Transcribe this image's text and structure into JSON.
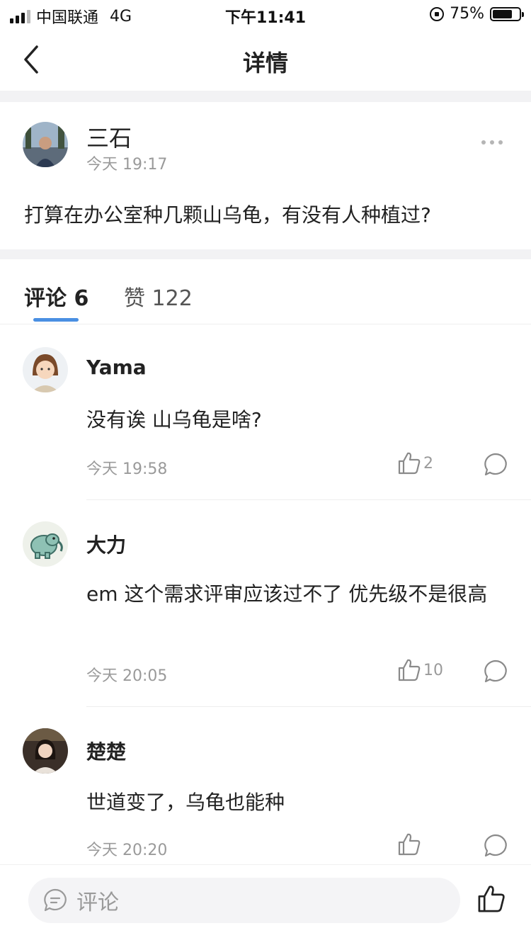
{
  "status_bar": {
    "carrier": "中国联通",
    "network": "4G",
    "time": "下午11:41",
    "battery_percent": "75%",
    "battery_level": 0.75
  },
  "nav": {
    "title": "详情",
    "back_icon": "chevron-left-icon"
  },
  "post": {
    "author": "三石",
    "time": "今天 19:17",
    "text": "打算在办公室种几颗山乌龟，有没有人种植过?",
    "more_icon": "more-dots-icon"
  },
  "tabs": {
    "comments": "评论 6",
    "likes": "赞 122",
    "accent_color": "#4a8fe2"
  },
  "comments": [
    {
      "name": "Yama",
      "text": "没有诶 山乌龟是啥?",
      "time": "今天 19:58",
      "likes": "2"
    },
    {
      "name": "大力",
      "text": "em 这个需求评审应该过不了 优先级不是很高",
      "time": "今天 20:05",
      "likes": "10"
    },
    {
      "name": "楚楚",
      "text": "世道变了，乌龟也能种",
      "time": "今天 20:20",
      "likes": ""
    }
  ],
  "bottom_bar": {
    "comment_placeholder": "评论",
    "comment_icon": "comment-bubble-icon",
    "like_icon": "thumbs-up-icon"
  }
}
